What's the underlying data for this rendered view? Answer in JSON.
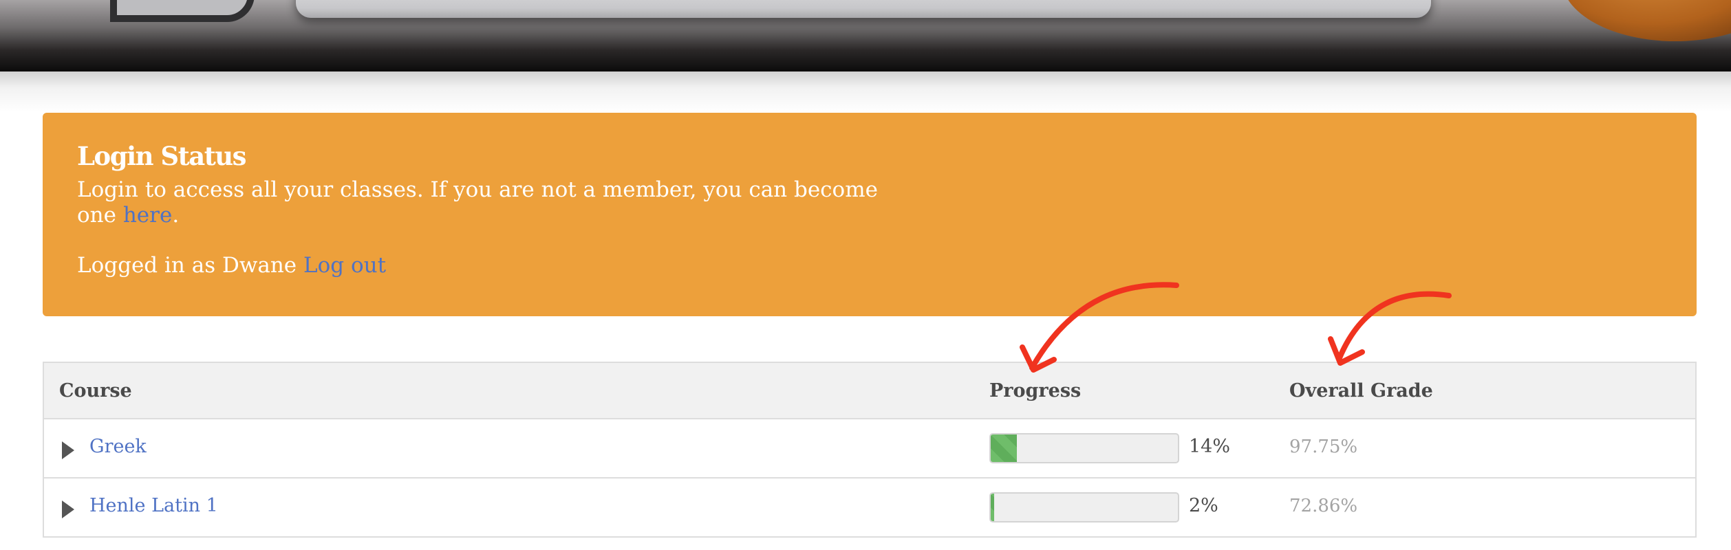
{
  "login_status": {
    "title": "Login Status",
    "message_prefix": "Login to access all your classes. If you are not a member, you can become one ",
    "message_link": "here",
    "message_suffix": ".",
    "logged_in_prefix": "Logged in as Dwane ",
    "logout_label": "Log out"
  },
  "table": {
    "headers": {
      "course": "Course",
      "progress": "Progress",
      "grade": "Overall Grade"
    },
    "rows": [
      {
        "course": "Greek",
        "progress_label": "14%",
        "progress_fraction": 0.14,
        "grade": "97.75%"
      },
      {
        "course": "Henle Latin 1",
        "progress_label": "2%",
        "progress_fraction": 0.02,
        "grade": "72.86%"
      }
    ]
  },
  "colors": {
    "panel_bg": "#eda03b",
    "link": "#4f72c4",
    "progress_fill": "#6fbd6a",
    "annotation": "#f0331f"
  },
  "icons": {
    "row_toggle": "triangle-right-icon",
    "annotation": "curved-arrow-icon"
  }
}
